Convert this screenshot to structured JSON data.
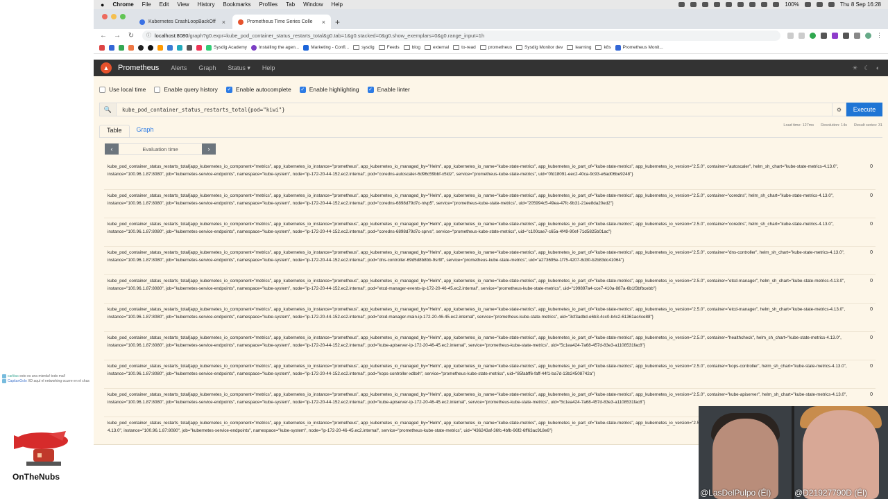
{
  "macos_menu": {
    "apple": "",
    "items": [
      "Chrome",
      "File",
      "Edit",
      "View",
      "History",
      "Bookmarks",
      "Profiles",
      "Tab",
      "Window",
      "Help"
    ],
    "battery": "100%",
    "clock": "Thu 8 Sep 16:28"
  },
  "browser": {
    "tabs": [
      {
        "title": "Kubernetes CrashLoopBackOff"
      },
      {
        "title": "Prometheus Time Series Colle"
      }
    ],
    "url_host": "localhost:8080",
    "url_path": "/graph?g0.expr=kube_pod_container_status_restarts_total&g0.tab=1&g0.stacked=0&g0.show_exemplars=0&g0.range_input=1h",
    "bookmarks": [
      "Sysdig Academy",
      "Installing the agen...",
      "Marketing - Confl...",
      "sysdig",
      "Feeds",
      "blog",
      "external",
      "to-read",
      "prometheus",
      "Sysdig Monitor dev",
      "learning",
      "k8s",
      "Prometheus Monit..."
    ]
  },
  "prometheus": {
    "brand": "Prometheus",
    "nav": [
      "Alerts",
      "Graph",
      "Status ▾",
      "Help"
    ],
    "options": [
      {
        "label": "Use local time",
        "checked": false
      },
      {
        "label": "Enable query history",
        "checked": false
      },
      {
        "label": "Enable autocomplete",
        "checked": true
      },
      {
        "label": "Enable highlighting",
        "checked": true
      },
      {
        "label": "Enable linter",
        "checked": true
      }
    ],
    "query": "kube_pod_container_status_restarts_total{pod=\"kiwi\"}",
    "execute_label": "Execute",
    "stats": {
      "load_time": "Load time: 127ms",
      "resolution": "Resolution: 14s",
      "result_series": "Result series: 31"
    },
    "tabs": [
      "Table",
      "Graph"
    ],
    "eval_placeholder": "Evaluation time",
    "results": [
      {
        "text": "kube_pod_container_status_restarts_total{app_kubernetes_io_component=\"metrics\", app_kubernetes_io_instance=\"prometheus\", app_kubernetes_io_managed_by=\"Helm\", app_kubernetes_io_name=\"kube-state-metrics\", app_kubernetes_io_part_of=\"kube-state-metrics\", app_kubernetes_io_version=\"2.5.0\", container=\"autoscaler\", helm_sh_chart=\"kube-state-metrics-4.13.0\", instance=\"100.96.1.87:8080\", job=\"kubernetes-service-endpoints\", namespace=\"kube-system\", node=\"ip-172-20-44-152.ec2.internal\", pod=\"coredns-autoscaler-6d96c59bbf-x5ldz\", service=\"prometheus-kube-state-metrics\", uid=\"0fd18091-eec2-40ca-9c93-e6ad06be9248\"}",
        "value": "0"
      },
      {
        "text": "kube_pod_container_status_restarts_total{app_kubernetes_io_component=\"metrics\", app_kubernetes_io_instance=\"prometheus\", app_kubernetes_io_managed_by=\"Helm\", app_kubernetes_io_name=\"kube-state-metrics\", app_kubernetes_io_part_of=\"kube-state-metrics\", app_kubernetes_io_version=\"2.5.0\", container=\"coredns\", helm_sh_chart=\"kube-state-metrics-4.13.0\", instance=\"100.96.1.87:8080\", job=\"kubernetes-service-endpoints\", namespace=\"kube-system\", node=\"ip-172-20-44-152.ec2.internal\", pod=\"coredns-6898d79d7c-ntvp5\", service=\"prometheus-kube-state-metrics\", uid=\"205994c5-49ea-47fc-9b31-21ee8da20ed2\"}",
        "value": "0"
      },
      {
        "text": "kube_pod_container_status_restarts_total{app_kubernetes_io_component=\"metrics\", app_kubernetes_io_instance=\"prometheus\", app_kubernetes_io_managed_by=\"Helm\", app_kubernetes_io_name=\"kube-state-metrics\", app_kubernetes_io_part_of=\"kube-state-metrics\", app_kubernetes_io_version=\"2.5.0\", container=\"coredns\", helm_sh_chart=\"kube-state-metrics-4.13.0\", instance=\"100.96.1.87:8080\", job=\"kubernetes-service-endpoints\", namespace=\"kube-system\", node=\"ip-172-20-44-152.ec2.internal\", pod=\"coredns-6898d79d7c-sprvs\", service=\"prometheus-kube-state-metrics\", uid=\"c100cae7-c65a-4f49-90ef-71d5825b01ac\"}",
        "value": "0"
      },
      {
        "text": "kube_pod_container_status_restarts_total{app_kubernetes_io_component=\"metrics\", app_kubernetes_io_instance=\"prometheus\", app_kubernetes_io_managed_by=\"Helm\", app_kubernetes_io_name=\"kube-state-metrics\", app_kubernetes_io_part_of=\"kube-state-metrics\", app_kubernetes_io_version=\"2.5.0\", container=\"dns-controller\", helm_sh_chart=\"kube-state-metrics-4.13.0\", instance=\"100.96.1.87:8080\", job=\"kubernetes-service-endpoints\", namespace=\"kube-system\", node=\"ip-172-20-44-152.ec2.internal\", pod=\"dns-controller-69d5d8b8bb-9sr9f\", service=\"prometheus-kube-state-metrics\", uid=\"a273695e-1f75-4207-8d30-b2b83dc41064\"}",
        "value": "0"
      },
      {
        "text": "kube_pod_container_status_restarts_total{app_kubernetes_io_component=\"metrics\", app_kubernetes_io_instance=\"prometheus\", app_kubernetes_io_managed_by=\"Helm\", app_kubernetes_io_name=\"kube-state-metrics\", app_kubernetes_io_part_of=\"kube-state-metrics\", app_kubernetes_io_version=\"2.5.0\", container=\"etcd-manager\", helm_sh_chart=\"kube-state-metrics-4.13.0\", instance=\"100.96.1.87:8080\", job=\"kubernetes-service-endpoints\", namespace=\"kube-system\", node=\"ip-172-20-44-152.ec2.internal\", pod=\"etcd-manager-events-ip-172-20-46-45.ec2.internal\", service=\"prometheus-kube-state-metrics\", uid=\"199897a4-cce7-410a-887a-6b1f3bfbcebb\"}",
        "value": "0"
      },
      {
        "text": "kube_pod_container_status_restarts_total{app_kubernetes_io_component=\"metrics\", app_kubernetes_io_instance=\"prometheus\", app_kubernetes_io_managed_by=\"Helm\", app_kubernetes_io_name=\"kube-state-metrics\", app_kubernetes_io_part_of=\"kube-state-metrics\", app_kubernetes_io_version=\"2.5.0\", container=\"etcd-manager\", helm_sh_chart=\"kube-state-metrics-4.13.0\", instance=\"100.96.1.87:8080\", job=\"kubernetes-service-endpoints\", namespace=\"kube-system\", node=\"ip-172-20-44-152.ec2.internal\", pod=\"etcd-manager-main-ip-172-20-46-45.ec2.internal\", service=\"prometheus-kube-state-metrics\", uid=\"3cf3adbd-e6b3-4cc0-b4c2-61361ac4ce88\"}",
        "value": "0"
      },
      {
        "text": "kube_pod_container_status_restarts_total{app_kubernetes_io_component=\"metrics\", app_kubernetes_io_instance=\"prometheus\", app_kubernetes_io_managed_by=\"Helm\", app_kubernetes_io_name=\"kube-state-metrics\", app_kubernetes_io_part_of=\"kube-state-metrics\", app_kubernetes_io_version=\"2.5.0\", container=\"healthcheck\", helm_sh_chart=\"kube-state-metrics-4.13.0\", instance=\"100.96.1.87:8080\", job=\"kubernetes-service-endpoints\", namespace=\"kube-system\", node=\"ip-172-20-44-152.ec2.internal\", pod=\"kube-apiserver-ip-172-20-46-45.ec2.internal\", service=\"prometheus-kube-state-metrics\", uid=\"5c1ea424-7a68-457d-83e3-a1108531fac8\"}",
        "value": "0"
      },
      {
        "text": "kube_pod_container_status_restarts_total{app_kubernetes_io_component=\"metrics\", app_kubernetes_io_instance=\"prometheus\", app_kubernetes_io_managed_by=\"Helm\", app_kubernetes_io_name=\"kube-state-metrics\", app_kubernetes_io_part_of=\"kube-state-metrics\", app_kubernetes_io_version=\"2.5.0\", container=\"kops-controller\", helm_sh_chart=\"kube-state-metrics-4.13.0\", instance=\"100.96.1.87:8080\", job=\"kubernetes-service-endpoints\", namespace=\"kube-system\", node=\"ip-172-20-44-152.ec2.internal\", pod=\"kops-controller-xdbxh\", service=\"prometheus-kube-state-metrics\", uid=\"85fabff6-faff-44f1-ba7d-13b24508742a\"}",
        "value": "0"
      },
      {
        "text": "kube_pod_container_status_restarts_total{app_kubernetes_io_component=\"metrics\", app_kubernetes_io_instance=\"prometheus\", app_kubernetes_io_managed_by=\"Helm\", app_kubernetes_io_name=\"kube-state-metrics\", app_kubernetes_io_part_of=\"kube-state-metrics\", app_kubernetes_io_version=\"2.5.0\", container=\"kube-apiserver\", helm_sh_chart=\"kube-state-metrics-4.13.0\", instance=\"100.96.1.87:8080\", job=\"kubernetes-service-endpoints\", namespace=\"kube-system\", node=\"ip-172-20-44-152.ec2.internal\", pod=\"kube-apiserver-ip-172-20-46-45.ec2.internal\", service=\"prometheus-kube-state-metrics\", uid=\"5c1ea424-7a68-457d-83e3-a1108531fac8\"}",
        "value": "0"
      },
      {
        "text": "kube_pod_container_status_restarts_total{app_kubernetes_io_component=\"metrics\", app_kubernetes_io_instance=\"prometheus\", app_kubernetes_io_managed_by=\"Helm\", app_kubernetes_io_name=\"kube-state-metrics\", app_kubernetes_io_part_of=\"kube-state-metrics\", app_kubernetes_io_version=\"2.5.0\", container=\"kube-controller-manager\", helm_sh_chart=\"kube-state-metrics-4.13.0\", instance=\"100.96.1.87:8080\", job=\"kubernetes-service-endpoints\", namespace=\"kube-system\", node=\"ip-172-20-46-45.ec2.internal\", service=\"prometheus-kube-state-metrics\", uid=\"436243af-36fc-4bfb-96f2-6ff63ac918e6\"}",
        "value": ""
      }
    ]
  },
  "overlay": {
    "chat": [
      {
        "user": "carlitas",
        "msg": "esto es una mierda! todo mal!"
      },
      {
        "user": "CapitanGolo",
        "msg": "XD aquí el networking ocurre en el chas"
      }
    ],
    "channel": "OnTheNubs",
    "cam_left": "@LasDelPulpo (Él)",
    "cam_right": "@D21927790D (Él)"
  }
}
